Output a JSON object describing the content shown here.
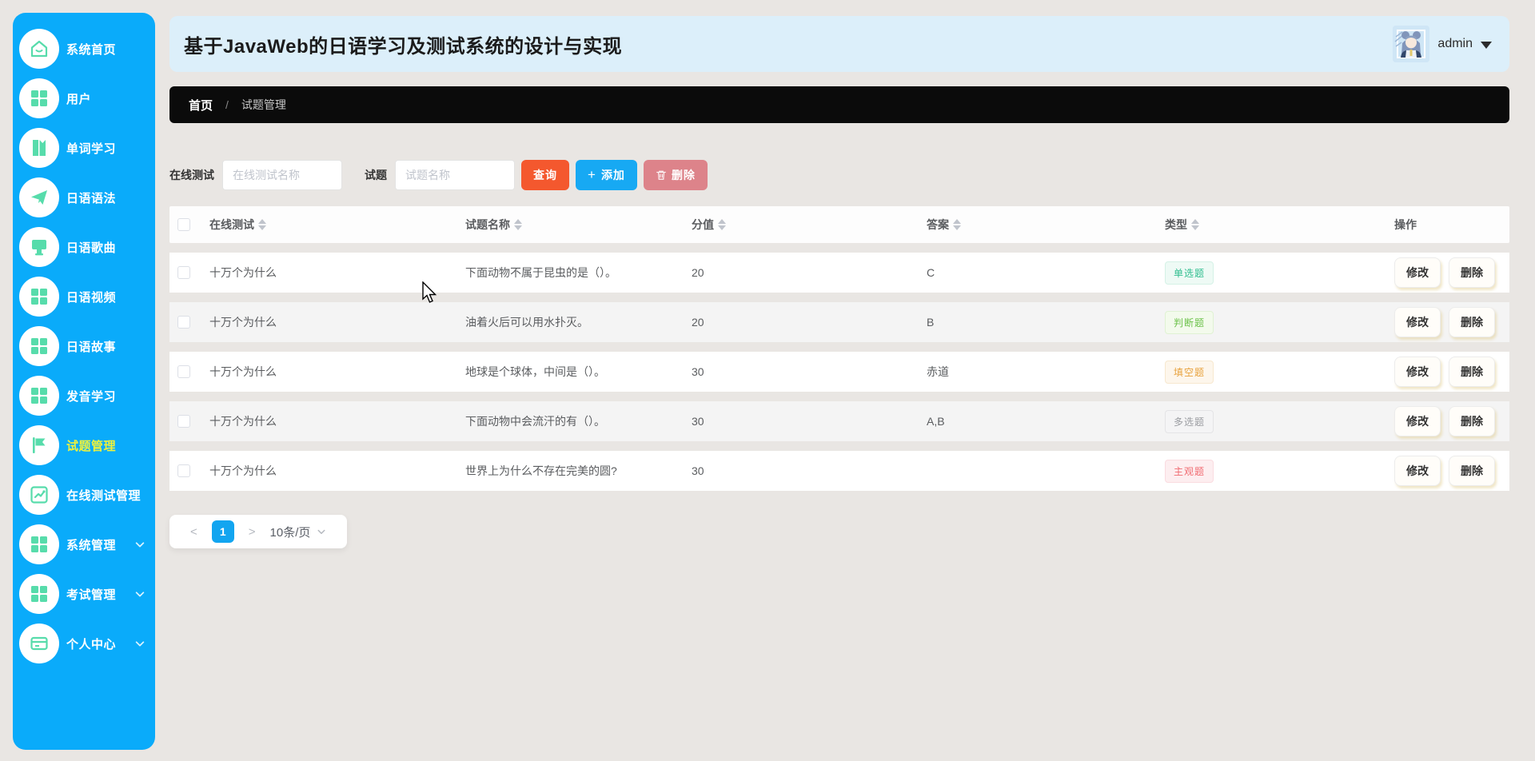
{
  "header": {
    "title": "基于JavaWeb的日语学习及测试系统的设计与实现",
    "user": {
      "name": "admin"
    }
  },
  "breadcrumb": {
    "home": "首页",
    "separator": "/",
    "current": "试题管理"
  },
  "search": {
    "field1_label": "在线测试",
    "field1_placeholder": "在线测试名称",
    "field1_value": "",
    "field2_label": "试题",
    "field2_placeholder": "试题名称",
    "field2_value": "",
    "query_label": "查询",
    "add_label": "添加",
    "delete_label": "删除"
  },
  "table": {
    "columns": [
      {
        "label": "在线测试",
        "sortable": true
      },
      {
        "label": "试题名称",
        "sortable": true
      },
      {
        "label": "分值",
        "sortable": true
      },
      {
        "label": "答案",
        "sortable": true
      },
      {
        "label": "类型",
        "sortable": true
      },
      {
        "label": "操作",
        "sortable": false
      }
    ],
    "rows": [
      {
        "test": "十万个为什么",
        "question": "下面动物不属于昆虫的是（）。",
        "score": "20",
        "answer": "C",
        "type": "单选题",
        "variant": "single"
      },
      {
        "test": "十万个为什么",
        "question": "油着火后可以用水扑灭。",
        "score": "20",
        "answer": "B",
        "type": "判断题",
        "variant": "judge"
      },
      {
        "test": "十万个为什么",
        "question": "地球是个球体，中间是（）。",
        "score": "30",
        "answer": "赤道",
        "type": "填空题",
        "variant": "fill"
      },
      {
        "test": "十万个为什么",
        "question": "下面动物中会流汗的有（）。",
        "score": "30",
        "answer": "A,B",
        "type": "多选题",
        "variant": "multi"
      },
      {
        "test": "十万个为什么",
        "question": "世界上为什么不存在完美的圆?",
        "score": "30",
        "answer": "",
        "type": "主观题",
        "variant": "subjective"
      }
    ],
    "edit_label": "修改",
    "delete_label": "删除"
  },
  "tag_colors": {
    "single": {
      "fg": "#2fbe8f",
      "bg": "#eefaf5",
      "border": "#d5f2e6"
    },
    "judge": {
      "fg": "#6cc24a",
      "bg": "#f3faec",
      "border": "#e0f2d3"
    },
    "fill": {
      "fg": "#e8a23d",
      "bg": "#fdf6ec",
      "border": "#f7e8cf"
    },
    "multi": {
      "fg": "#9a9ca1",
      "bg": "#f4f4f5",
      "border": "#e4e4e6"
    },
    "subjective": {
      "fg": "#f16c72",
      "bg": "#fdeef0",
      "border": "#fadce0"
    }
  },
  "pagination": {
    "prev": "<",
    "page": "1",
    "next": ">",
    "page_size": "10条/页"
  },
  "sidebar": {
    "items": [
      {
        "id": "home",
        "label": "系统首页",
        "icon": "home",
        "active": false,
        "expandable": false
      },
      {
        "id": "users",
        "label": "用户",
        "icon": "grid",
        "active": false,
        "expandable": false
      },
      {
        "id": "words",
        "label": "单词学习",
        "icon": "book",
        "active": false,
        "expandable": false
      },
      {
        "id": "grammar",
        "label": "日语语法",
        "icon": "plane",
        "active": false,
        "expandable": false
      },
      {
        "id": "songs",
        "label": "日语歌曲",
        "icon": "billboard",
        "active": false,
        "expandable": false
      },
      {
        "id": "videos",
        "label": "日语视频",
        "icon": "grid",
        "active": false,
        "expandable": false
      },
      {
        "id": "stories",
        "label": "日语故事",
        "icon": "grid",
        "active": false,
        "expandable": false
      },
      {
        "id": "pronounce",
        "label": "发音学习",
        "icon": "grid",
        "active": false,
        "expandable": false
      },
      {
        "id": "questions",
        "label": "试题管理",
        "icon": "flag",
        "active": true,
        "expandable": false
      },
      {
        "id": "online-test",
        "label": "在线测试管理",
        "icon": "chart",
        "active": false,
        "expandable": false
      },
      {
        "id": "system",
        "label": "系统管理",
        "icon": "grid",
        "active": false,
        "expandable": true
      },
      {
        "id": "exam",
        "label": "考试管理",
        "icon": "grid",
        "active": false,
        "expandable": true
      },
      {
        "id": "profile",
        "label": "个人中心",
        "icon": "card",
        "active": false,
        "expandable": true
      }
    ]
  },
  "colors": {
    "sidebar": "#0aabfa",
    "sidebar_icon": "#57dcab",
    "active_item": "#eef23c",
    "query_btn": "#f4582e",
    "add_btn": "#17a9f3",
    "delete_btn": "#dd838a",
    "page_num": "#12a5f0",
    "header_band": "#dceffa"
  }
}
